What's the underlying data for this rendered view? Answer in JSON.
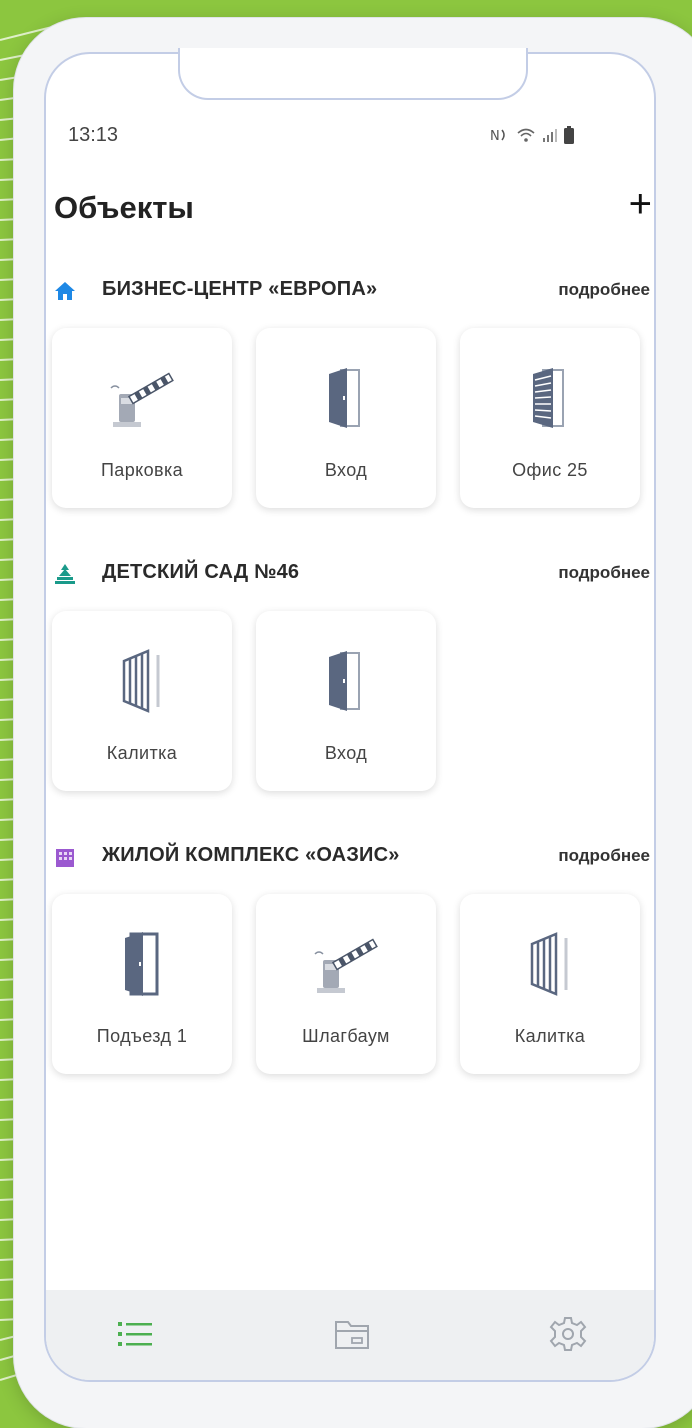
{
  "status": {
    "time": "13:13"
  },
  "header": {
    "title": "Объекты",
    "add_label": "+"
  },
  "sections": [
    {
      "title": "БИЗНЕС-ЦЕНТР «ЕВРОПА»",
      "more": "подробнее",
      "icon": "home-icon",
      "icon_color": "#1e88e5",
      "cards": [
        {
          "label": "Парковка",
          "icon": "barrier-icon"
        },
        {
          "label": "Вход",
          "icon": "door-icon"
        },
        {
          "label": "Офис 25",
          "icon": "shutter-door-icon"
        }
      ]
    },
    {
      "title": "ДЕТСКИЙ САД №46",
      "more": "подробнее",
      "icon": "kindergarten-icon",
      "icon_color": "#1a9a8a",
      "cards": [
        {
          "label": "Калитка",
          "icon": "gate-icon"
        },
        {
          "label": "Вход",
          "icon": "door-icon"
        }
      ]
    },
    {
      "title": "ЖИЛОЙ КОМПЛЕКС «ОАЗИС»",
      "more": "подробнее",
      "icon": "building-icon",
      "icon_color": "#9b59d0",
      "cards": [
        {
          "label": "Подъезд 1",
          "icon": "door-icon"
        },
        {
          "label": "Шлагбаум",
          "icon": "barrier-icon"
        },
        {
          "label": "Калитка",
          "icon": "gate-icon"
        }
      ]
    }
  ],
  "tabbar": {
    "active": "list-icon",
    "accent": "#4caf50"
  }
}
